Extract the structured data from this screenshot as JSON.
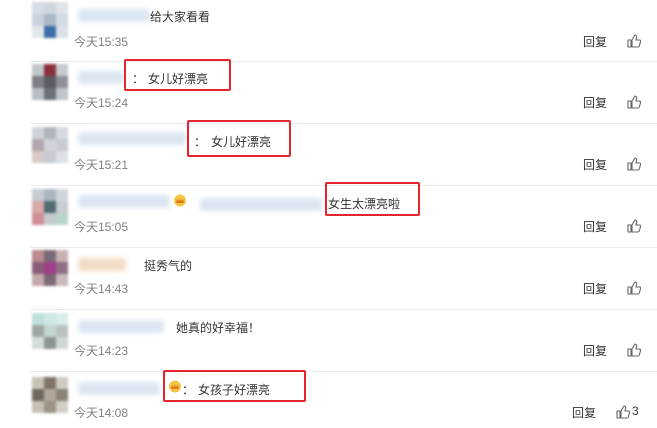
{
  "comments": [
    {
      "text": "给大家看看",
      "time": "今天15:35",
      "reply": "回复"
    },
    {
      "text": "女儿好漂亮",
      "time": "今天15:24",
      "reply": "回复"
    },
    {
      "text": "女儿好漂亮",
      "time": "今天15:21",
      "reply": "回复"
    },
    {
      "text": "女生太漂亮啦",
      "time": "今天15:05",
      "reply": "回复"
    },
    {
      "text": "挺秀气的",
      "time": "今天14:43",
      "reply": "回复"
    },
    {
      "text": "她真的好幸福！",
      "time": "今天14:23",
      "reply": "回复"
    },
    {
      "text": "女孩子好漂亮",
      "time": "今天14:08",
      "reply": "回复",
      "likes": "3"
    }
  ],
  "colon": "：",
  "icons": {
    "like": "thumbs-up-icon",
    "crown": "crown-icon"
  },
  "colors": {
    "highlight": "#e5242b",
    "time": "#808080"
  }
}
